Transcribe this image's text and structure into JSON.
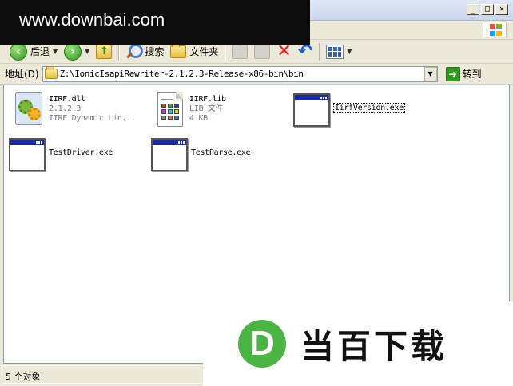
{
  "watermark": {
    "text": "www.downbai.com"
  },
  "title_bar": {
    "minimize": "_",
    "maximize": "□",
    "close": "✕"
  },
  "toolbar": {
    "back_label": "后退",
    "search_label": "搜索",
    "folders_label": "文件夹"
  },
  "address": {
    "label": "地址(D)",
    "path": "Z:\\IonicIsapiRewriter-2.1.2.3-Release-x86-bin\\bin",
    "go_label": "转到"
  },
  "files": [
    {
      "name": "IIRF.dll",
      "meta1": "2.1.2.3",
      "meta2": "IIRF Dynamic Lin...",
      "icon": "dll-gear-icon"
    },
    {
      "name": "IIRF.lib",
      "meta1": "LIB 文件",
      "meta2": "4 KB",
      "icon": "lib-file-icon"
    },
    {
      "name": "IirfVersion.exe",
      "icon": "exe-window-icon"
    },
    {
      "name": "TestDriver.exe",
      "icon": "exe-window-icon"
    },
    {
      "name": "TestParse.exe",
      "icon": "exe-window-icon"
    }
  ],
  "status": {
    "count_text": "5 个对象"
  },
  "brand": {
    "logo_letter": "D",
    "name": "当百下载"
  },
  "colors": {
    "accent_green": "#4bb543",
    "title_blue": "#1b2b9a"
  }
}
